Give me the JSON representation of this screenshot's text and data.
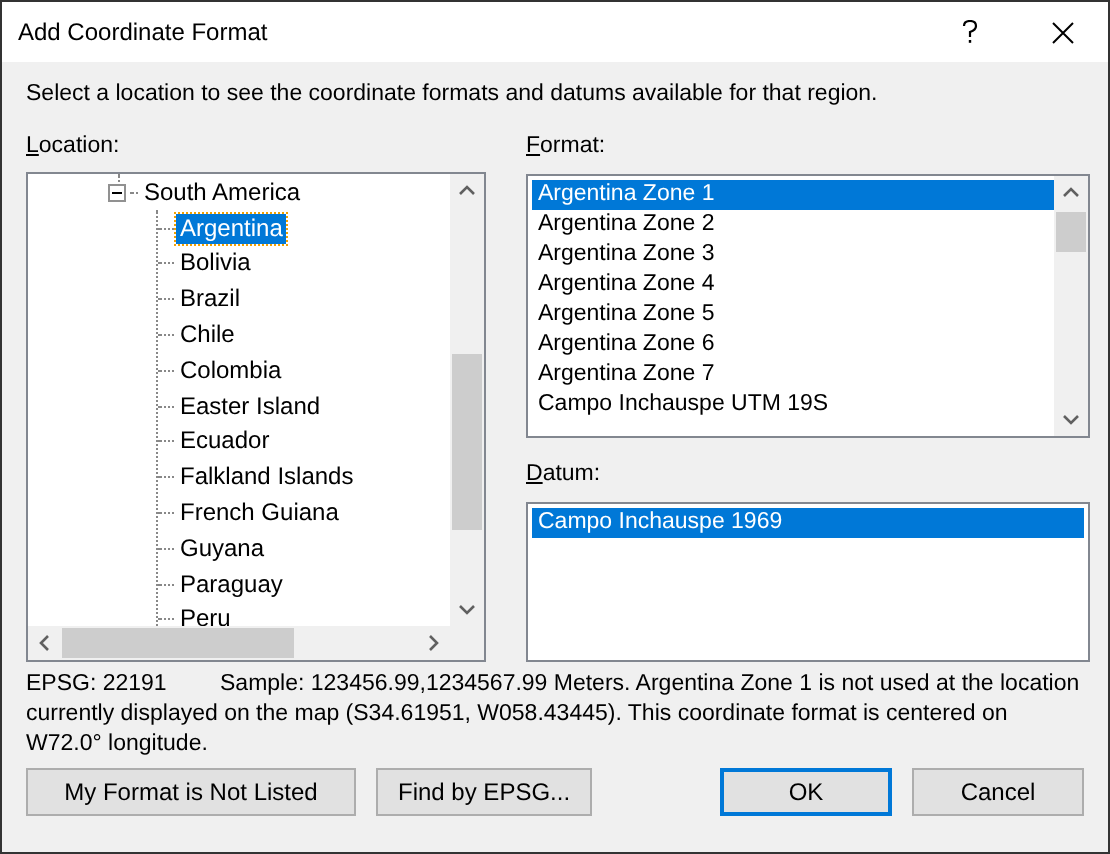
{
  "window": {
    "title": "Add Coordinate Format"
  },
  "instructions": "Select a location to see the coordinate formats and datums available for that region.",
  "location": {
    "label": "Location:",
    "tree": [
      {
        "label": "South America",
        "expanded": true,
        "children": [
          {
            "label": "Argentina",
            "selected": true
          },
          {
            "label": "Bolivia",
            "selected": false
          },
          {
            "label": "Brazil",
            "selected": false
          },
          {
            "label": "Chile",
            "selected": false
          },
          {
            "label": "Colombia",
            "selected": false
          },
          {
            "label": "Easter Island",
            "selected": false
          },
          {
            "label": "Ecuador",
            "selected": false
          },
          {
            "label": "Falkland Islands",
            "selected": false
          },
          {
            "label": "French Guiana",
            "selected": false
          },
          {
            "label": "Guyana",
            "selected": false
          },
          {
            "label": "Paraguay",
            "selected": false
          },
          {
            "label": "Peru",
            "selected": false
          }
        ]
      }
    ]
  },
  "format": {
    "label": "Format:",
    "items": [
      {
        "label": "Argentina Zone 1",
        "selected": true
      },
      {
        "label": "Argentina Zone 2",
        "selected": false
      },
      {
        "label": "Argentina Zone 3",
        "selected": false
      },
      {
        "label": "Argentina Zone 4",
        "selected": false
      },
      {
        "label": "Argentina Zone 5",
        "selected": false
      },
      {
        "label": "Argentina Zone 6",
        "selected": false
      },
      {
        "label": "Argentina Zone 7",
        "selected": false
      },
      {
        "label": "Campo Inchauspe UTM 19S",
        "selected": false
      }
    ]
  },
  "datum": {
    "label": "Datum:",
    "items": [
      {
        "label": "Campo Inchauspe 1969",
        "selected": true
      }
    ]
  },
  "info": {
    "epsg": "EPSG: 22191",
    "description": "Sample: 123456.99,1234567.99 Meters.  Argentina Zone 1 is not used at the location currently displayed on the map (S34.61951, W058.43445).  This coordinate format is centered on W72.0° longitude."
  },
  "buttons": [
    {
      "label": "My Format is Not Listed",
      "default": false
    },
    {
      "label": "Find by EPSG...",
      "default": false
    },
    {
      "label": "OK",
      "default": true
    },
    {
      "label": "Cancel",
      "default": false
    }
  ]
}
